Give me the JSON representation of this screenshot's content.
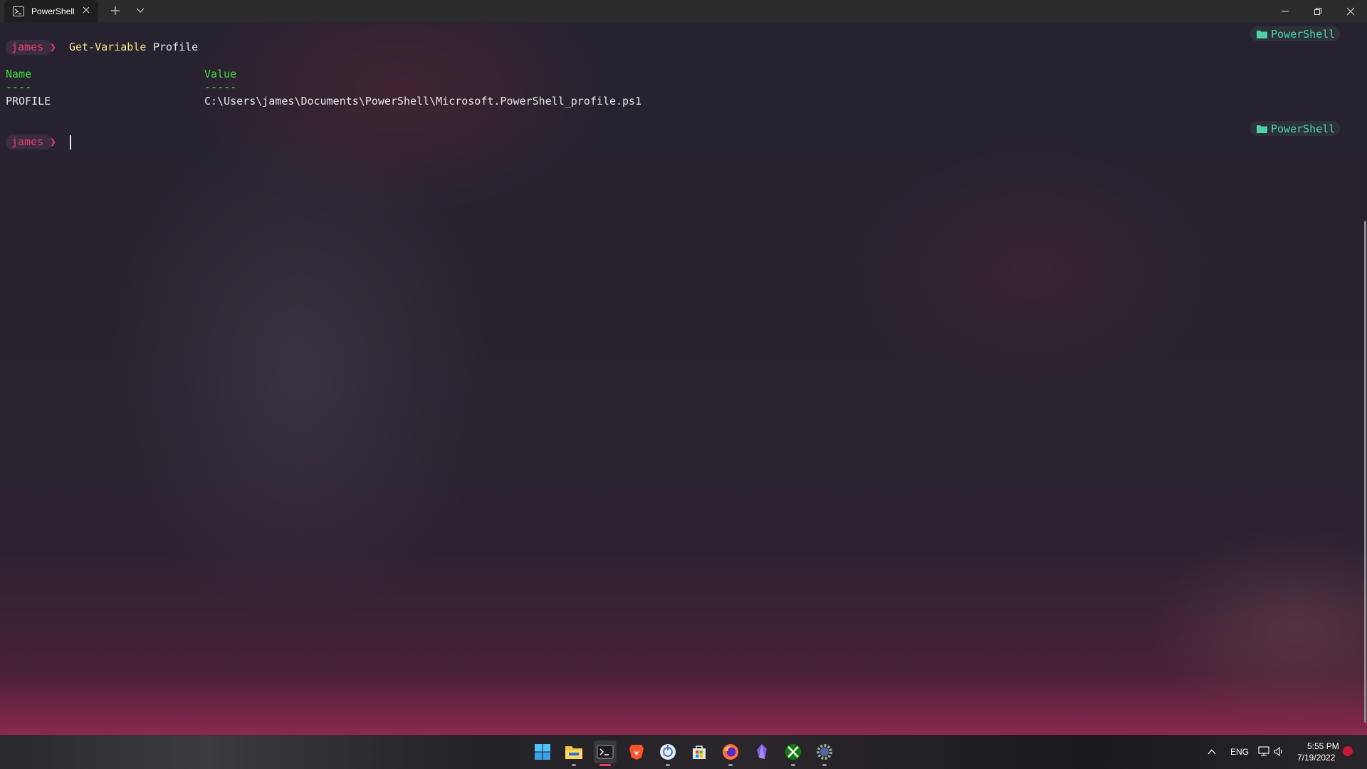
{
  "window": {
    "tab_title": "PowerShell"
  },
  "terminal": {
    "prompt_user": "james",
    "prompt_arrow": "❯",
    "command_name": "Get-Variable",
    "command_arg": "Profile",
    "table": {
      "headers": [
        "Name",
        "Value"
      ],
      "underlines": [
        "----",
        "-----"
      ],
      "rows": [
        [
          "PROFILE",
          "C:\\Users\\james\\Documents\\PowerShell\\Microsoft.PowerShell_profile.ps1"
        ]
      ]
    },
    "badge_label": "PowerShell"
  },
  "taskbar": {
    "apps": [
      "windows-start",
      "file-explorer",
      "windows-terminal",
      "brave-browser",
      "app-circle",
      "microsoft-store",
      "firefox",
      "obsidian",
      "xbox",
      "settings"
    ],
    "tray": {
      "language": "ENG",
      "time": "5:55 PM",
      "date": "7/19/2022"
    }
  },
  "colors": {
    "prompt_accent": "#e0406a",
    "command_yellow": "#f5e28c",
    "header_green": "#3ddc3d",
    "badge_teal": "#4fd1a5"
  }
}
